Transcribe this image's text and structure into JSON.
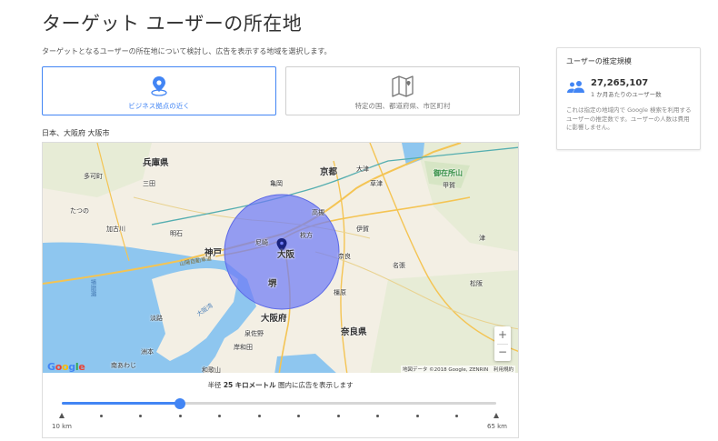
{
  "page": {
    "title": "ターゲット ユーザーの所在地",
    "description": "ターゲットとなるユーザーの所在地について検討し、広告を表示する地域を選択します。"
  },
  "options": [
    {
      "label": "ビジネス拠点の近く",
      "icon": "location-pin-icon",
      "selected": true
    },
    {
      "label": "特定の国、都道府県、市区町村",
      "icon": "folded-map-icon",
      "selected": false
    }
  ],
  "location_label": "日本、大阪府 大阪市",
  "map": {
    "labels": {
      "hyogo": "兵庫県",
      "sannomiya": "三田",
      "nishinomiya_north": "多可町",
      "tatsuno": "たつの",
      "kakogawa": "加古川",
      "akashi": "明石",
      "kobe": "神戸",
      "osaka": "大阪",
      "sakai": "堺",
      "kyoto": "京都",
      "nara": "奈良",
      "nara_pref": "奈良県",
      "osaka_pref": "大阪府",
      "wakayama": "和歌山",
      "awaji": "淡路",
      "sumoto": "洲本",
      "minamiawaji": "南あわじ",
      "koka": "甲賀",
      "iga": "伊賀",
      "nabari": "名張",
      "kashihara": "橿原",
      "kishiwada": "岸和田",
      "takatsuki": "高槻",
      "hirakata": "枚方",
      "kusatsu": "草津",
      "otsu": "大津",
      "kameoka": "亀岡",
      "amagasaki": "尼崎",
      "izumisano": "泉佐野",
      "matsusaka": "松阪",
      "tsu": "津",
      "suzuka_park": "御在所山",
      "sea_harima": "播磨灘",
      "sea_osaka": "大阪湾",
      "highway_sanyo": "山陽自動車道"
    },
    "attribution": "地図データ ©2018 Google, ZENRIN",
    "terms": "利用規約",
    "google": "Google",
    "zoom_in": "+",
    "zoom_out": "−"
  },
  "radius": {
    "prefix": "半径",
    "value": "25",
    "unit": "キロメートル",
    "suffix": "圏内に広告を表示します",
    "min_label": "10 km",
    "max_label": "65 km",
    "min_km": 10,
    "max_km": 65,
    "current_km": 25,
    "tick_count": 12
  },
  "estimate": {
    "heading": "ユーザーの推定規模",
    "count": "27,265,107",
    "count_sub": "1 か月あたりのユーザー数",
    "note": "これは指定の地域内で Google 検索を利用するユーザーの推定数です。ユーザーの人数は費用に影響しません。",
    "icon": "users-icon"
  },
  "colors": {
    "accent": "#4285f4",
    "radius_fill": "#6f7cf5",
    "water": "#8ec6ef",
    "land": "#f3efe4"
  }
}
